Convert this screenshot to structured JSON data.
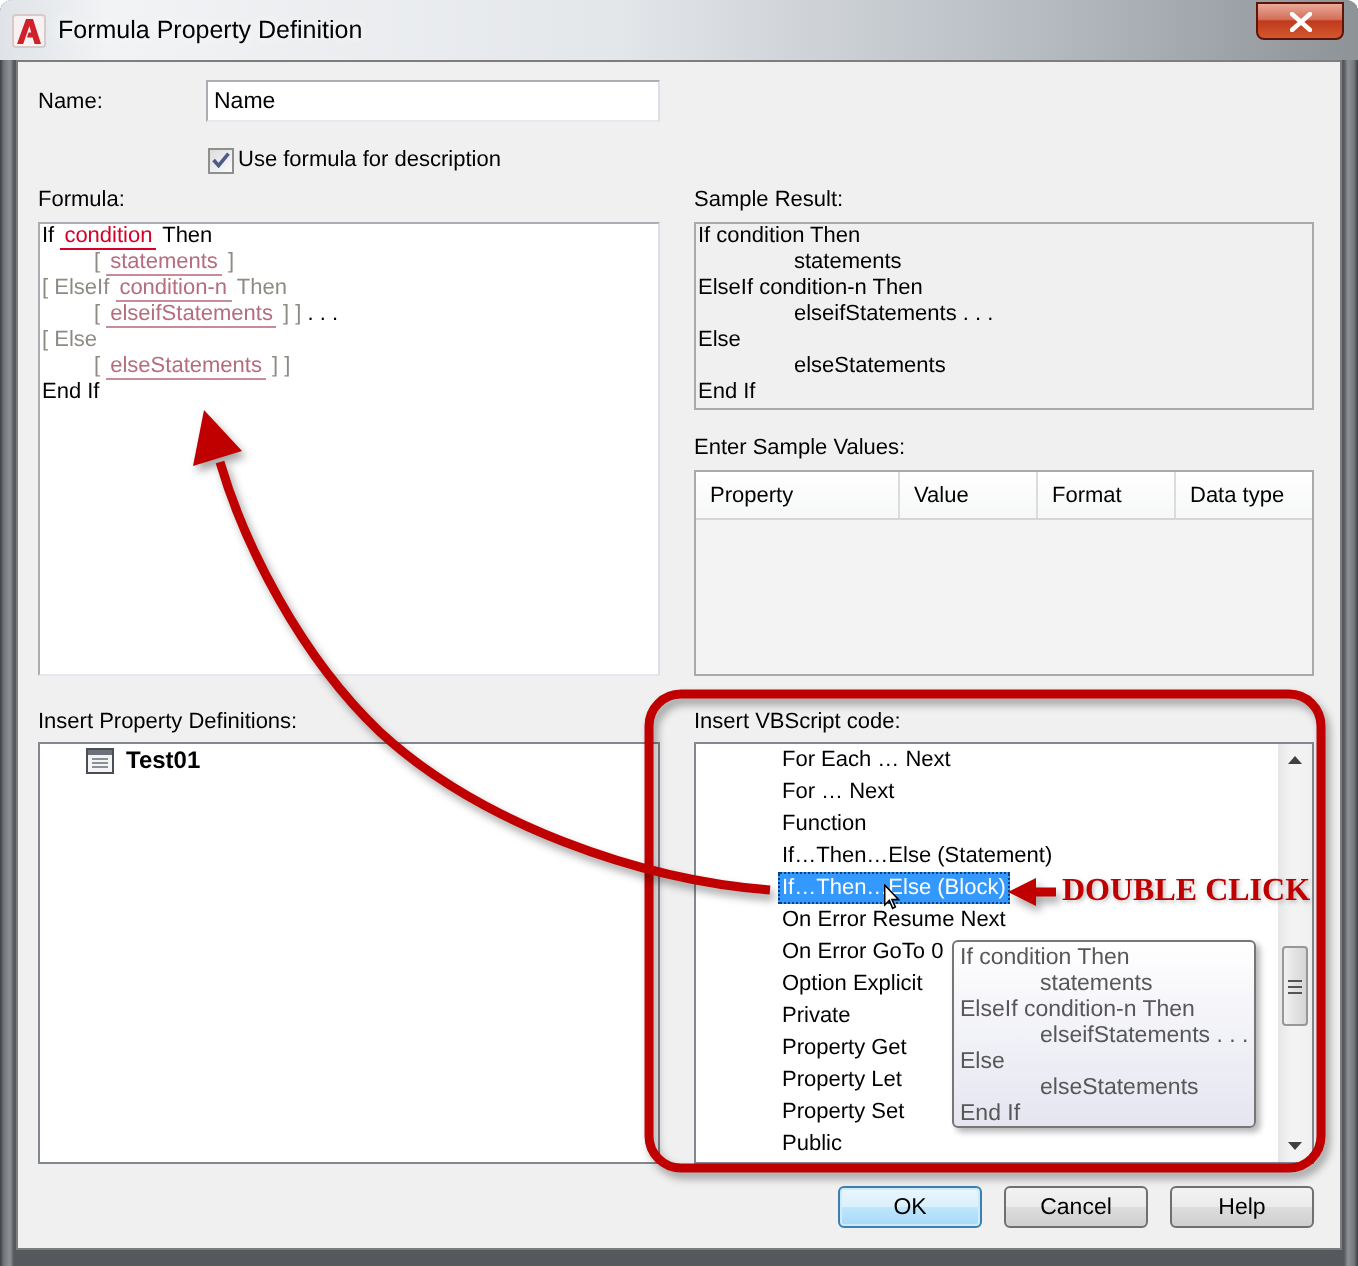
{
  "window": {
    "title": "Formula Property Definition"
  },
  "name_field": {
    "label": "Name:",
    "value": "Name"
  },
  "use_formula": {
    "label": "Use formula for description",
    "checked": true
  },
  "formula": {
    "label": "Formula:",
    "lines": [
      {
        "indented": false,
        "tokens": [
          {
            "text": "If",
            "kind": "keyword"
          },
          {
            "text": "condition",
            "kind": "current"
          },
          {
            "text": "Then",
            "kind": "keyword"
          }
        ]
      },
      {
        "indented": true,
        "tokens": [
          {
            "text": "[",
            "kind": "optional"
          },
          {
            "text": "statements",
            "kind": "field"
          },
          {
            "text": "]",
            "kind": "optional"
          }
        ]
      },
      {
        "indented": false,
        "tokens": [
          {
            "text": "[ ElseIf",
            "kind": "optional"
          },
          {
            "text": "condition-n",
            "kind": "field"
          },
          {
            "text": "Then",
            "kind": "optional"
          }
        ]
      },
      {
        "indented": true,
        "tokens": [
          {
            "text": "[",
            "kind": "optional"
          },
          {
            "text": "elseifStatements",
            "kind": "field"
          },
          {
            "text": "] ]",
            "kind": "optional"
          },
          {
            "text": ". . .",
            "kind": "keyword"
          }
        ]
      },
      {
        "indented": false,
        "tokens": [
          {
            "text": "[ Else",
            "kind": "optional"
          }
        ]
      },
      {
        "indented": true,
        "tokens": [
          {
            "text": "[",
            "kind": "optional"
          },
          {
            "text": "elseStatements",
            "kind": "field"
          },
          {
            "text": "] ]",
            "kind": "optional"
          }
        ]
      },
      {
        "indented": false,
        "tokens": [
          {
            "text": "End If",
            "kind": "keyword"
          }
        ]
      }
    ]
  },
  "sample_result": {
    "label": "Sample Result:",
    "lines": [
      {
        "text": "If condition Then",
        "indented": false
      },
      {
        "text": "statements",
        "indented": true
      },
      {
        "text": "ElseIf condition-n Then",
        "indented": false
      },
      {
        "text": "elseifStatements . . .",
        "indented": true
      },
      {
        "text": "Else",
        "indented": false
      },
      {
        "text": "elseStatements",
        "indented": true
      },
      {
        "text": "End If",
        "indented": false
      }
    ]
  },
  "sample_values": {
    "label": "Enter Sample Values:",
    "columns": [
      "Property",
      "Value",
      "Format",
      "Data type"
    ]
  },
  "property_definitions": {
    "label": "Insert Property Definitions:",
    "items": [
      {
        "label": "Test01",
        "selected": false
      }
    ]
  },
  "vbscript": {
    "label": "Insert VBScript code:",
    "items": [
      {
        "label": "For Each … Next",
        "selected": false
      },
      {
        "label": "For … Next",
        "selected": false
      },
      {
        "label": "Function",
        "selected": false
      },
      {
        "label": "If…Then…Else (Statement)",
        "selected": false
      },
      {
        "label": "If…Then…Else (Block)",
        "selected": true
      },
      {
        "label": "On Error Resume Next",
        "selected": false
      },
      {
        "label": "On Error GoTo 0",
        "selected": false
      },
      {
        "label": "Option Explicit",
        "selected": false
      },
      {
        "label": "Private",
        "selected": false
      },
      {
        "label": "Property Get",
        "selected": false
      },
      {
        "label": "Property Let",
        "selected": false
      },
      {
        "label": "Property Set",
        "selected": false
      },
      {
        "label": "Public",
        "selected": false
      }
    ]
  },
  "tooltip": {
    "lines": [
      {
        "text": "If condition Then",
        "indented": false
      },
      {
        "text": "statements",
        "indented": true
      },
      {
        "text": "ElseIf condition-n Then",
        "indented": false
      },
      {
        "text": "elseifStatements . . .",
        "indented": true
      },
      {
        "text": "Else",
        "indented": false
      },
      {
        "text": "elseStatements",
        "indented": true
      },
      {
        "text": "End If",
        "indented": false
      }
    ]
  },
  "annotation": {
    "text": "DOUBLE CLICK"
  },
  "buttons": [
    {
      "label": "OK",
      "default": true
    },
    {
      "label": "Cancel",
      "default": false
    },
    {
      "label": "Help",
      "default": false
    }
  ]
}
